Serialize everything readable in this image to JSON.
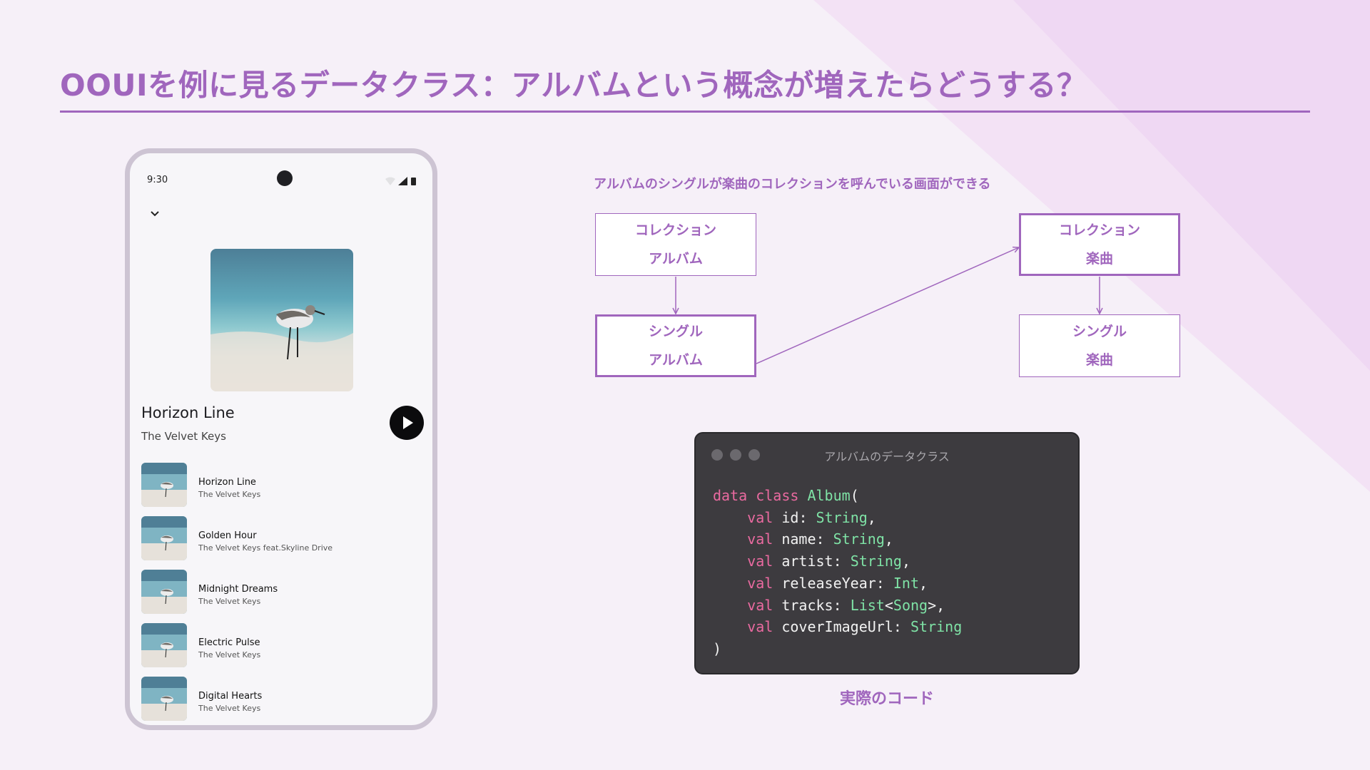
{
  "title": "OOUIを例に見るデータクラス：アルバムという概念が増えたらどうする？",
  "colors": {
    "accent": "#a066bd",
    "code_keyword": "#ea6aa0",
    "code_type": "#7fe3a6",
    "code_bg": "#3d3b3f"
  },
  "phone": {
    "time": "9:30",
    "status_icons": [
      "wifi-icon",
      "signal-icon",
      "battery-icon"
    ],
    "now_playing": {
      "title": "Horizon Line",
      "artist": "The Velvet Keys"
    },
    "songs": [
      {
        "title": "Horizon Line",
        "artist": "The Velvet Keys"
      },
      {
        "title": "Golden Hour",
        "artist": "The Velvet Keys feat.Skyline Drive"
      },
      {
        "title": "Midnight Dreams",
        "artist": "The Velvet Keys"
      },
      {
        "title": "Electric Pulse",
        "artist": "The Velvet Keys"
      },
      {
        "title": "Digital Hearts",
        "artist": "The Velvet Keys"
      }
    ]
  },
  "diagram": {
    "caption": "アルバムのシングルが楽曲のコレクションを呼んでいる画面ができる",
    "boxes": {
      "album_collection": {
        "type": "コレクション",
        "object": "アルバム",
        "emphasis": false
      },
      "album_single": {
        "type": "シングル",
        "object": "アルバム",
        "emphasis": true
      },
      "song_collection": {
        "type": "コレクション",
        "object": "楽曲",
        "emphasis": true
      },
      "song_single": {
        "type": "シングル",
        "object": "楽曲",
        "emphasis": false
      }
    }
  },
  "code_window": {
    "title": "アルバムのデータクラス",
    "code": {
      "l1_kw": "data class",
      "l1_name": "Album",
      "f1_kw": "val",
      "f1_name": "id",
      "f1_type": "String",
      "f2_kw": "val",
      "f2_name": "name",
      "f2_type": "String",
      "f3_kw": "val",
      "f3_name": "artist",
      "f3_type": "String",
      "f4_kw": "val",
      "f4_name": "releaseYear",
      "f4_type": "Int",
      "f5_kw": "val",
      "f5_name": "tracks",
      "f5_type_outer": "List",
      "f5_type_inner": "Song",
      "f6_kw": "val",
      "f6_name": "coverImageUrl",
      "f6_type": "String",
      "close": ")"
    },
    "caption": "実際のコード"
  }
}
